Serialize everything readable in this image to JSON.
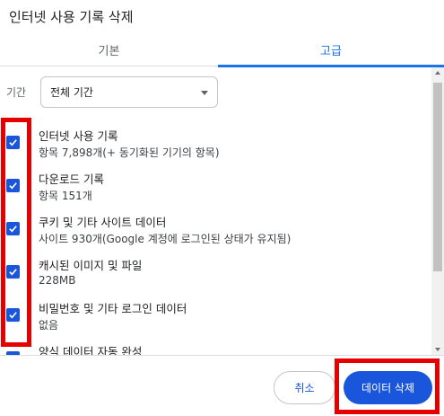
{
  "dialog": {
    "title": "인터넷 사용 기록 삭제"
  },
  "tabs": [
    {
      "label": "기본",
      "selected": false
    },
    {
      "label": "고급",
      "selected": true
    }
  ],
  "time_range": {
    "label": "기간",
    "selected_value": "전체 기간"
  },
  "items": [
    {
      "title": "인터넷 사용 기록",
      "subtitle": "항목 7,898개(+ 동기화된 기기의 항목)",
      "checked": true
    },
    {
      "title": "다운로드 기록",
      "subtitle": "항목 151개",
      "checked": true
    },
    {
      "title": "쿠키 및 기타 사이트 데이터",
      "subtitle": "사이트 930개(Google 계정에 로그인된 상태가 유지됨)",
      "checked": true
    },
    {
      "title": "캐시된 이미지 및 파일",
      "subtitle": "228MB",
      "checked": true
    },
    {
      "title": "비밀번호 및 기타 로그인 데이터",
      "subtitle": "없음",
      "checked": true
    },
    {
      "title": "양식 데이터 자동 완성",
      "subtitle": "",
      "checked": true
    }
  ],
  "footer": {
    "cancel_label": "취소",
    "delete_label": "데이터 삭제"
  },
  "colors": {
    "accent": "#1a56db",
    "tab_active": "#1a73e8",
    "annotation_red": "#e60000"
  }
}
